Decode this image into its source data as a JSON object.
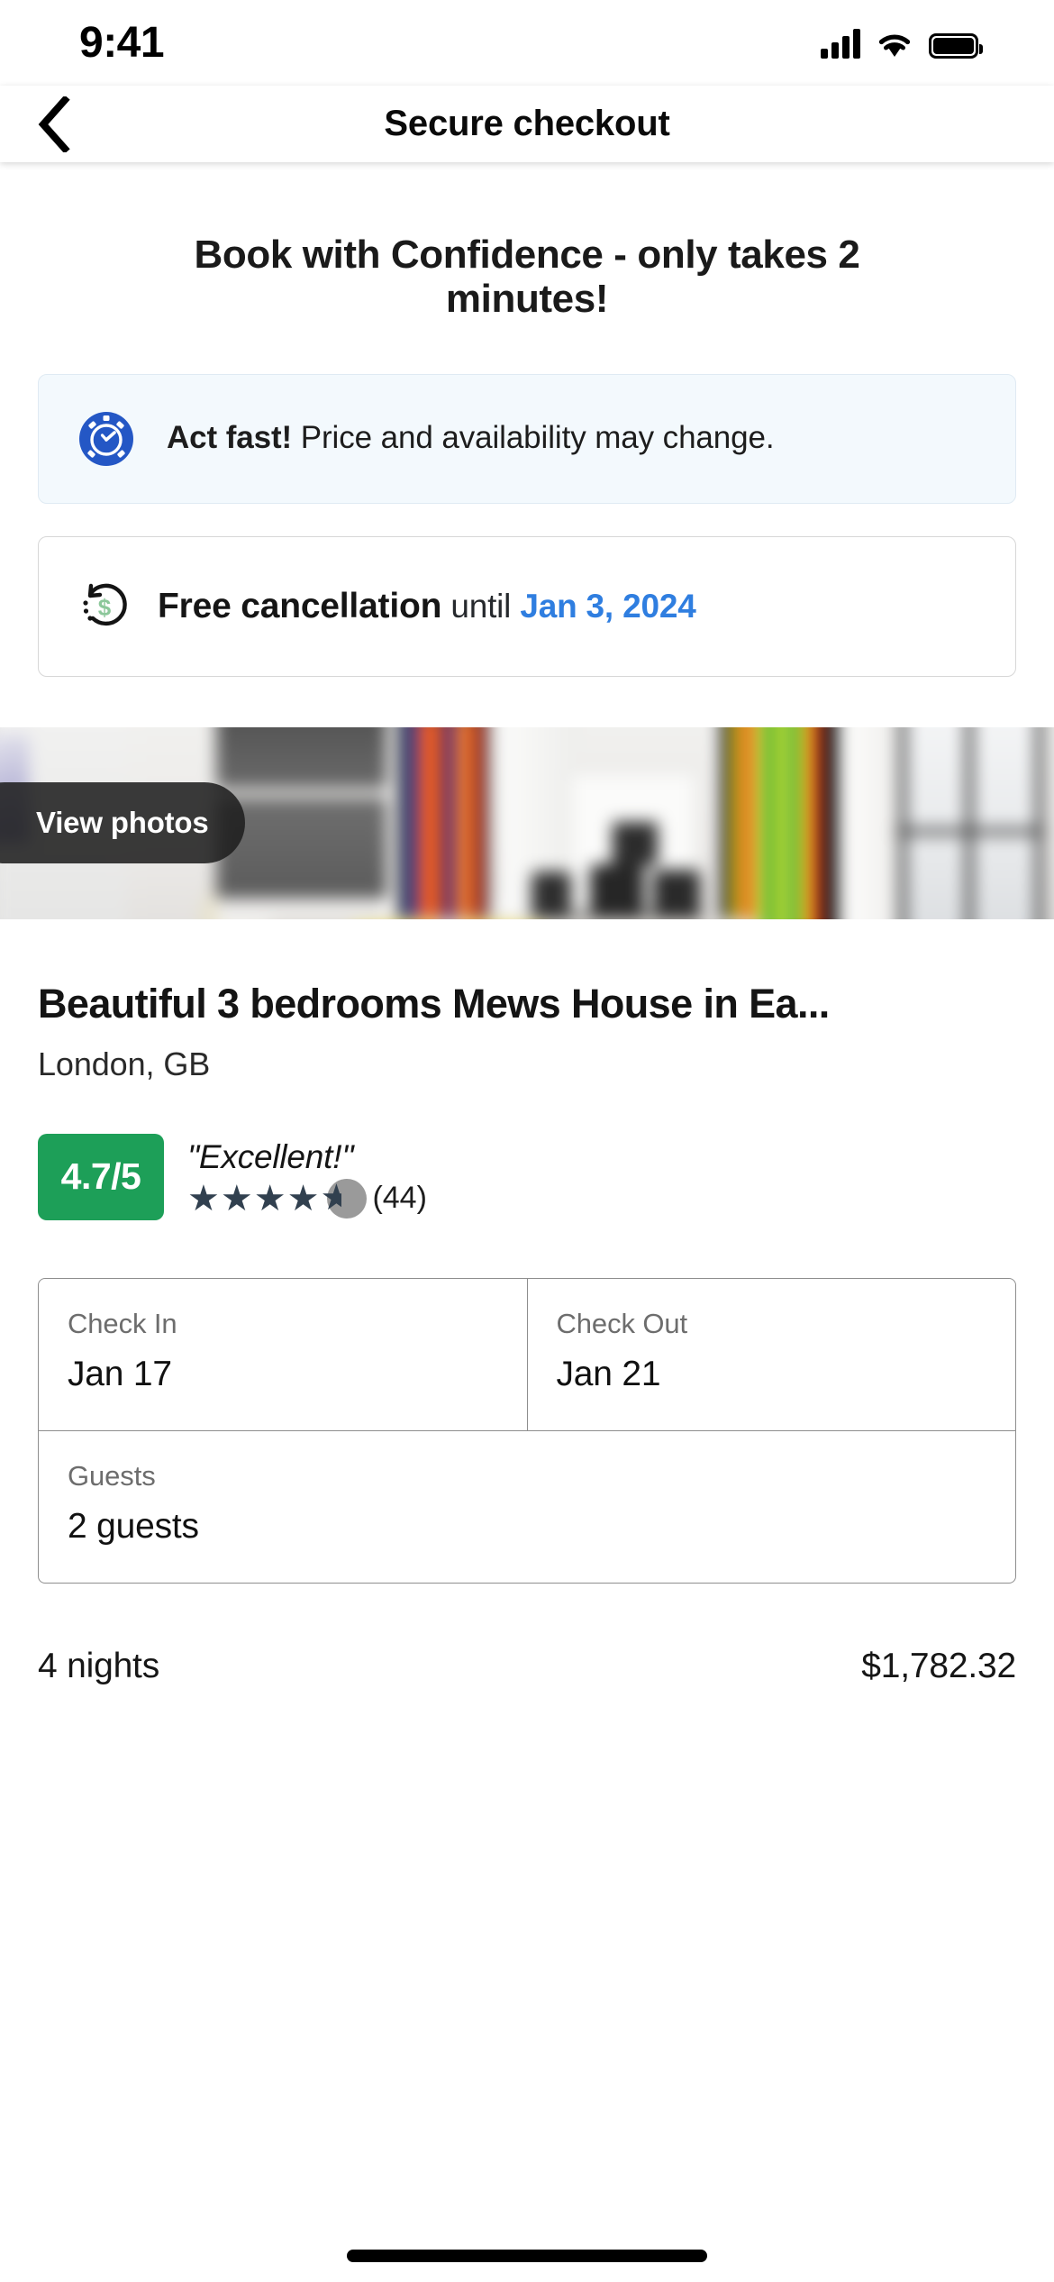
{
  "status_bar": {
    "time": "9:41",
    "cellular_icon": "signal-bars-icon",
    "wifi_icon": "wifi-icon",
    "battery_icon": "battery-full-icon"
  },
  "nav": {
    "back_icon": "chevron-left-icon",
    "title": "Secure checkout"
  },
  "headline": "Book with Confidence - only takes 2 minutes!",
  "act_fast": {
    "icon": "stopwatch-icon",
    "icon_color": "#2457c5",
    "bold": "Act fast!",
    "rest": " Price and availability may change.",
    "background": "#f3f9fd",
    "border": "#dfeaf3"
  },
  "free_cancellation": {
    "icon": "money-back-refund-icon",
    "icon_accent": "#8cc79a",
    "bold": "Free cancellation",
    "until": "until",
    "date": "Jan 3, 2024",
    "date_color": "#2f7ee0"
  },
  "photo": {
    "view_photos_label": "View photos",
    "alt": "blurred modern living room with grey sofa, yellow cushions and colorful striped wall art"
  },
  "property": {
    "title": "Beautiful 3 bedrooms Mews House in Ea...",
    "location": "London, GB"
  },
  "rating": {
    "score": "4.7/5",
    "score_color": "#1d9f58",
    "verdict": "\"Excellent!\"",
    "stars_filled": 4,
    "stars_half": 1,
    "stars_total": 5,
    "star_color": "#31404f",
    "review_count": "(44)"
  },
  "booking": {
    "check_in_label": "Check In",
    "check_in_value": "Jan 17",
    "check_out_label": "Check Out",
    "check_out_value": "Jan 21",
    "guests_label": "Guests",
    "guests_value": "2 guests"
  },
  "totals": {
    "nights": "4 nights",
    "amount": "$1,782.32"
  }
}
